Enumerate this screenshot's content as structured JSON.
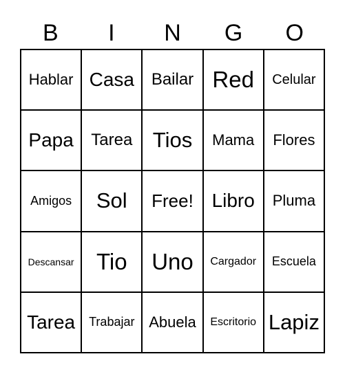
{
  "header": {
    "letters": [
      "B",
      "I",
      "N",
      "G",
      "O"
    ]
  },
  "board": {
    "rows": [
      [
        "Hablar",
        "Casa",
        "Bailar",
        "Red",
        "Celular"
      ],
      [
        "Papa",
        "Tarea",
        "Tios",
        "Mama",
        "Flores"
      ],
      [
        "Amigos",
        "Sol",
        "Free!",
        "Libro",
        "Pluma"
      ],
      [
        "Descansar",
        "Tio",
        "Uno",
        "Cargador",
        "Escuela"
      ],
      [
        "Tarea",
        "Trabajar",
        "Abuela",
        "Escritorio",
        "Lapiz"
      ]
    ]
  }
}
